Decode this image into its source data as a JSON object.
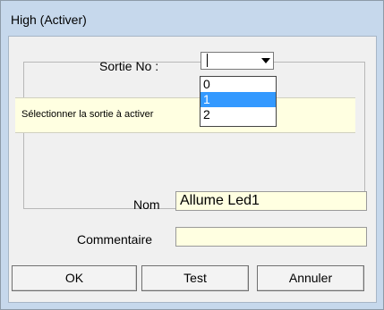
{
  "window": {
    "title": "High (Activer)"
  },
  "sortie": {
    "label": "Sortie No :",
    "value": "",
    "options": [
      "0",
      "1",
      "2"
    ],
    "highlighted": "1"
  },
  "info": {
    "text": "Sélectionner la sortie à activer"
  },
  "nom": {
    "label": "Nom",
    "value": "Allume Led1"
  },
  "commentaire": {
    "label": "Commentaire",
    "value": ""
  },
  "buttons": {
    "ok": "OK",
    "test": "Test",
    "annuler": "Annuler"
  },
  "colors": {
    "frame": "#c6d8ec",
    "field_bg": "#ffffe1",
    "highlight": "#3399ff"
  }
}
